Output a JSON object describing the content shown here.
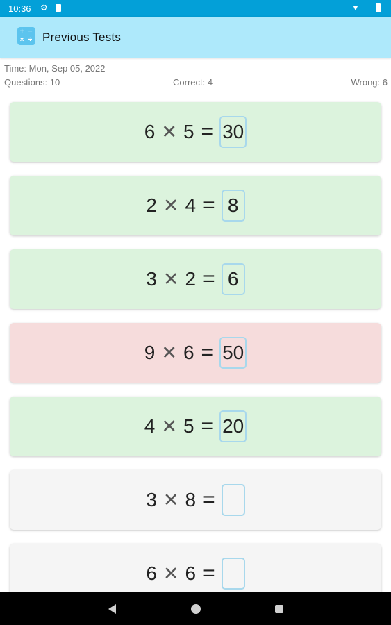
{
  "status_bar": {
    "time": "10:36",
    "icons": [
      "gear-icon",
      "sd-card-icon",
      "wifi-icon",
      "battery-icon"
    ]
  },
  "app_bar": {
    "title": "Previous Tests",
    "icon": "calculator-app-icon",
    "icon_glyphs": [
      "+",
      "−",
      "×",
      "÷"
    ]
  },
  "summary": {
    "time": "Time: Mon, Sep 05, 2022",
    "questions": "Questions: 10",
    "correct": "Correct: 4",
    "wrong": "Wrong: 6"
  },
  "questions": [
    {
      "a": "6",
      "op": "✕",
      "b": "5",
      "eq": "=",
      "answer": "30",
      "status": "correct"
    },
    {
      "a": "2",
      "op": "✕",
      "b": "4",
      "eq": "=",
      "answer": "8",
      "status": "correct"
    },
    {
      "a": "3",
      "op": "✕",
      "b": "2",
      "eq": "=",
      "answer": "6",
      "status": "correct"
    },
    {
      "a": "9",
      "op": "✕",
      "b": "6",
      "eq": "=",
      "answer": "50",
      "status": "wrong"
    },
    {
      "a": "4",
      "op": "✕",
      "b": "5",
      "eq": "=",
      "answer": "20",
      "status": "correct"
    },
    {
      "a": "3",
      "op": "✕",
      "b": "8",
      "eq": "=",
      "answer": "",
      "status": "unanswered"
    },
    {
      "a": "6",
      "op": "✕",
      "b": "6",
      "eq": "=",
      "answer": "",
      "status": "unanswered"
    }
  ],
  "colors": {
    "status_bar": "#03a0d8",
    "app_bar": "#aee9fb",
    "correct": "#dcf3dd",
    "wrong": "#f6dcdc",
    "unanswered": "#f5f5f5",
    "answer_border": "#a8d8ec"
  },
  "nav_bar": {
    "icons": [
      "back-icon",
      "home-icon",
      "recents-icon"
    ]
  }
}
